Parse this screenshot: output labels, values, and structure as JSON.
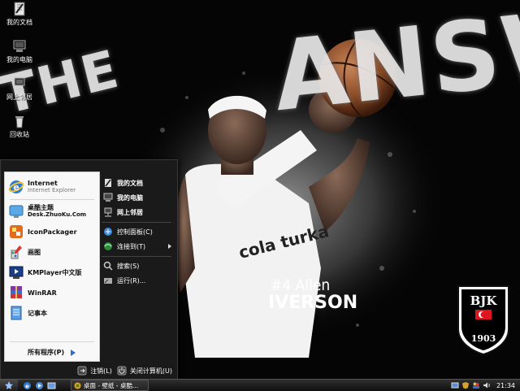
{
  "desktop": {
    "icons": [
      {
        "label": "我的文档",
        "icon": "my-documents-icon"
      },
      {
        "label": "我的电脑",
        "icon": "my-computer-icon"
      },
      {
        "label": "网上邻居",
        "icon": "network-places-icon"
      },
      {
        "label": "回收站",
        "icon": "recycle-bin-icon"
      }
    ]
  },
  "wallpaper": {
    "text_the": "THE",
    "text_answer": "ANSWER",
    "player_number_name": "#4 Allen",
    "player_surname": "IVERSON",
    "jersey_text": "cola turka",
    "logo_text": "BJK",
    "logo_year": "1903"
  },
  "start_menu": {
    "left": [
      {
        "title": "Internet",
        "subtitle": "Internet Explorer",
        "icon": "internet-explorer-icon"
      },
      {
        "title": "桌酷主题",
        "subtitle": "Desk.ZhuoKu.Com",
        "icon": "zhuoku-theme-icon"
      },
      {
        "title": "IconPackager",
        "subtitle": "",
        "icon": "iconpackager-icon"
      },
      {
        "title": "画图",
        "subtitle": "",
        "icon": "paint-icon"
      },
      {
        "title": "KMPlayer中文版",
        "subtitle": "",
        "icon": "kmplayer-icon"
      },
      {
        "title": "WinRAR",
        "subtitle": "",
        "icon": "winrar-icon"
      },
      {
        "title": "记事本",
        "subtitle": "",
        "icon": "notepad-icon"
      }
    ],
    "all_programs": "所有程序(P)",
    "right": [
      {
        "label": "我的文档",
        "icon": "my-documents-icon"
      },
      {
        "label": "我的电脑",
        "icon": "my-computer-icon"
      },
      {
        "label": "网上邻居",
        "icon": "network-places-icon"
      },
      {
        "label": "控制面板(C)",
        "icon": "control-panel-icon"
      },
      {
        "label": "连接到(T)",
        "icon": "connect-to-icon"
      },
      {
        "label": "搜索(S)",
        "icon": "search-icon"
      },
      {
        "label": "运行(R)...",
        "icon": "run-icon"
      }
    ],
    "logoff": "注销(L)",
    "shutdown": "关闭计算机(U)"
  },
  "taskbar": {
    "task_label": "桌面 - 壁纸 - 桌酷...",
    "clock": "21:34"
  },
  "colors": {
    "accent_blue": "#2b6fcf",
    "taskbar_dark": "#101010",
    "menu_dark": "#1a1a1a"
  }
}
